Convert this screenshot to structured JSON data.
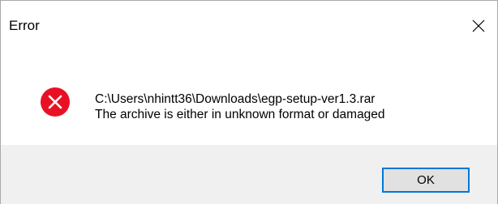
{
  "window": {
    "title": "Error"
  },
  "titlebar": {
    "close_icon": "close-icon"
  },
  "dialog": {
    "icon": "error-icon",
    "icon_color": "#e81123",
    "path_line": "C:\\Users\\nhintt36\\Downloads\\egp-setup-ver1.3.rar",
    "message_line": "The archive is either in unknown format or damaged"
  },
  "footer": {
    "ok_label": "OK",
    "accent_color": "#0078d7"
  }
}
